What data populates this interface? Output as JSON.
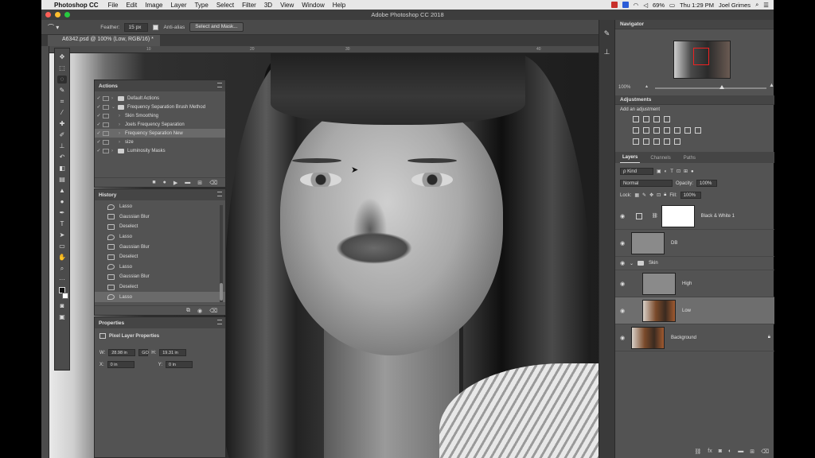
{
  "menubar": {
    "app_name": "Photoshop CC",
    "items": [
      "File",
      "Edit",
      "Image",
      "Layer",
      "Type",
      "Select",
      "Filter",
      "3D",
      "View",
      "Window",
      "Help"
    ],
    "battery": "69%",
    "clock": "Thu 1:29 PM",
    "user": "Joel Grimes",
    "colors": {
      "red_square": "#c8302a",
      "blue_square": "#2a5bd7"
    }
  },
  "window": {
    "title": "Adobe Photoshop CC 2018"
  },
  "options": {
    "feather_label": "Feather:",
    "feather_value": "15 px",
    "anti_alias_label": "Anti-alias",
    "select_mask_label": "Select and Mask..."
  },
  "document": {
    "tab_title": "A6342.psd @ 100% (Low, RGB/16) *"
  },
  "ruler": {
    "ticks": [
      "10",
      "20",
      "30",
      "40"
    ]
  },
  "tools": [
    "move",
    "marquee",
    "lasso",
    "quick-select",
    "crop",
    "eyedropper",
    "heal",
    "brush",
    "stamp",
    "history-brush",
    "eraser",
    "gradient",
    "blur",
    "dodge",
    "pen",
    "type",
    "path-select",
    "shape",
    "hand",
    "zoom",
    "more"
  ],
  "actions": {
    "title": "Actions",
    "rows": [
      {
        "label": "Default Actions",
        "check": "✓",
        "folder": true,
        "indent": 0
      },
      {
        "label": "Frequency Separation Brush Method",
        "check": "✓",
        "folder": true,
        "indent": 0,
        "expanded": true
      },
      {
        "label": "Skin Smoothing",
        "check": "✓",
        "folder": false,
        "indent": 1
      },
      {
        "label": "Joels Frequency Separation",
        "check": "✓",
        "folder": false,
        "indent": 1
      },
      {
        "label": "Frequency Separation New",
        "check": "✓",
        "folder": false,
        "indent": 1,
        "selected": true
      },
      {
        "label": "size",
        "check": "✓",
        "folder": false,
        "indent": 1
      },
      {
        "label": "Luminosity Masks",
        "check": "✓",
        "folder": true,
        "indent": 0
      }
    ]
  },
  "history": {
    "title": "History",
    "rows": [
      {
        "label": "Lasso",
        "kind": "lasso"
      },
      {
        "label": "Gaussian Blur",
        "kind": "doc"
      },
      {
        "label": "Deselect",
        "kind": "doc"
      },
      {
        "label": "Lasso",
        "kind": "lasso"
      },
      {
        "label": "Gaussian Blur",
        "kind": "doc"
      },
      {
        "label": "Deselect",
        "kind": "doc"
      },
      {
        "label": "Lasso",
        "kind": "lasso"
      },
      {
        "label": "Gaussian Blur",
        "kind": "doc"
      },
      {
        "label": "Deselect",
        "kind": "doc"
      },
      {
        "label": "Lasso",
        "kind": "lasso",
        "current": true
      }
    ]
  },
  "properties": {
    "title": "Properties",
    "subtitle": "Pixel Layer Properties",
    "w_label": "W:",
    "w_value": "28.98 in",
    "go_label": "GO",
    "h_label": "H:",
    "h_value": "19.31 in",
    "x_label": "X:",
    "x_value": "0 in",
    "y_label": "Y:",
    "y_value": "0 in"
  },
  "navigator": {
    "title": "Navigator",
    "zoom": "100%",
    "zoom_fraction": 0.6
  },
  "adjustments": {
    "title": "Adjustments",
    "add_label": "Add an adjustment",
    "row1": [
      "brightness-icon",
      "levels-icon",
      "curves-icon",
      "exposure-icon"
    ],
    "row2": [
      "vibrance-icon",
      "hue-sat-icon",
      "color-balance-icon",
      "bw-icon",
      "photo-filter-icon",
      "channel-mixer-icon",
      "color-lookup-icon"
    ],
    "row3": [
      "invert-icon",
      "posterize-icon",
      "threshold-icon",
      "gradient-map-icon",
      "selective-color-icon"
    ]
  },
  "layers_panel": {
    "tabs": [
      "Layers",
      "Channels",
      "Paths"
    ],
    "kind_label": "ρ Kind",
    "blend_mode": "Normal",
    "opacity_label": "Opacity:",
    "opacity_value": "100%",
    "lock_label": "Lock:",
    "fill_label": "Fill:",
    "fill_value": "100%",
    "layers": [
      {
        "name": "Black & White 1",
        "type": "adjustment"
      },
      {
        "name": "DB",
        "type": "gray"
      },
      {
        "name": "Skin",
        "type": "group"
      },
      {
        "name": "High",
        "type": "gray"
      },
      {
        "name": "Low",
        "type": "photo",
        "selected": true
      },
      {
        "name": "Background",
        "type": "photo"
      }
    ]
  }
}
